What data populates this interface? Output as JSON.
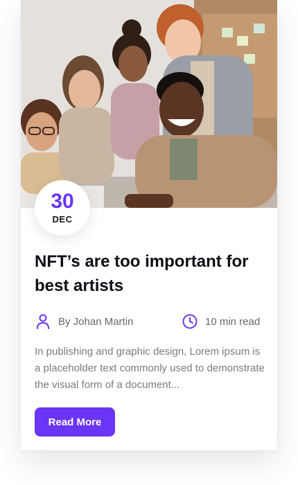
{
  "post": {
    "date": {
      "day": "30",
      "month": "DEC"
    },
    "title": "NFT’s are too important for best artists",
    "author": "By Johan Martin",
    "read_time": "10 min read",
    "excerpt": "In publishing and graphic design, Lorem ipsum is a placeholder text commonly used to demonstrate the visual form of a document...",
    "button_label": "Read More"
  },
  "icons": {
    "author": "user-icon",
    "read_time": "clock-icon"
  },
  "colors": {
    "accent": "#6a35f5",
    "title": "#0c0c14",
    "meta": "#66666e",
    "body": "#7a7a82"
  }
}
